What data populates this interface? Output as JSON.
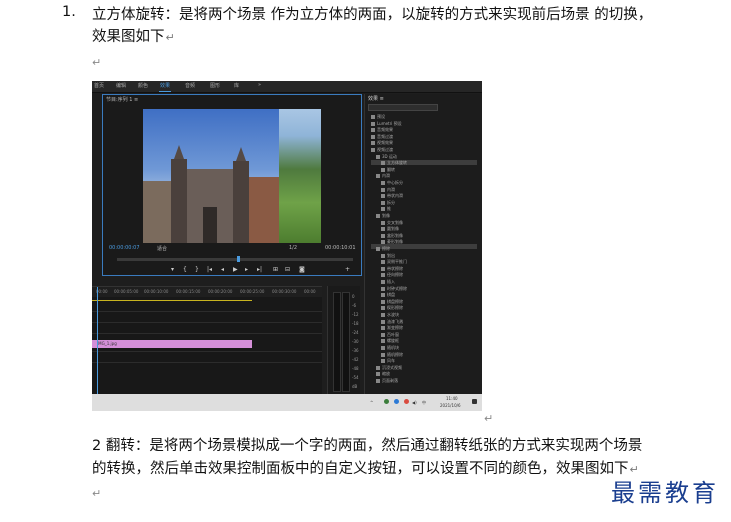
{
  "list": {
    "number": "1.",
    "line1": "立方体旋转：是将两个场景 作为立方体的两面，以旋转的方式来实现前后场景 的切换，",
    "line2": "效果图如下"
  },
  "para_mark": "↵",
  "paragraph2": {
    "line1": "2 翻转：是将两个场景模拟成一个字的两面，然后通过翻转纸张的方式来实现两个场景",
    "line2": "的转换，然后单击效果控制面板中的自定义按钮，可以设置不同的颜色，效果图如下"
  },
  "watermark": "最需教育",
  "screenshot": {
    "menu": [
      "首页",
      "编辑",
      "颜色",
      "效果",
      "音频",
      "图形",
      "库",
      "»"
    ],
    "active_menu_index": 3,
    "program_title": "节目:序列 1 ≡",
    "timecode_left": "00:00:00:07",
    "fit_label": "适合",
    "ratio": "1/2",
    "timecode_right": "00:00:10:01",
    "effects_title": "效果 ≡",
    "effects_items": [
      "预设",
      "Lumetri 预设",
      "音频效果",
      "音频过渡",
      "视频效果",
      "视频过渡",
      "3D 运动",
      "立方体旋转",
      "翻转",
      "内滑",
      "中心拆分",
      "内滑",
      "带状内滑",
      "拆分",
      "推",
      "划像",
      "交叉划像",
      "圆划像",
      "盒形划像",
      "菱形划像",
      "擦除",
      "划出",
      "双侧平推门",
      "带状擦除",
      "径向擦除",
      "插入",
      "时钟式擦除",
      "棋盘",
      "棋盘擦除",
      "楔形擦除",
      "水波块",
      "油漆飞溅",
      "渐变擦除",
      "百叶窗",
      "螺旋框",
      "随机块",
      "随机擦除",
      "风车",
      "沉浸式视频",
      "缩放",
      "页面剥落"
    ],
    "ruler_ticks": [
      "00:00",
      "00:00:05:00",
      "00:00:10:00",
      "00:00:15:00",
      "00:00:20:00",
      "00:00:25:00",
      "00:00:30:00",
      "00:00"
    ],
    "clip_label": "IMG_1.jpg",
    "meter_labels": [
      "0",
      "-6",
      "-12",
      "-18",
      "-24",
      "-30",
      "-36",
      "-42",
      "-48",
      "-54",
      "dB"
    ],
    "tray_lang": "中",
    "clock_time": "11:40",
    "clock_date": "2021/10/6"
  },
  "colors": {
    "accent_blue": "#4a9bdf",
    "clip_pink": "#d58fd8",
    "watermark_blue": "#1a3e8f"
  }
}
